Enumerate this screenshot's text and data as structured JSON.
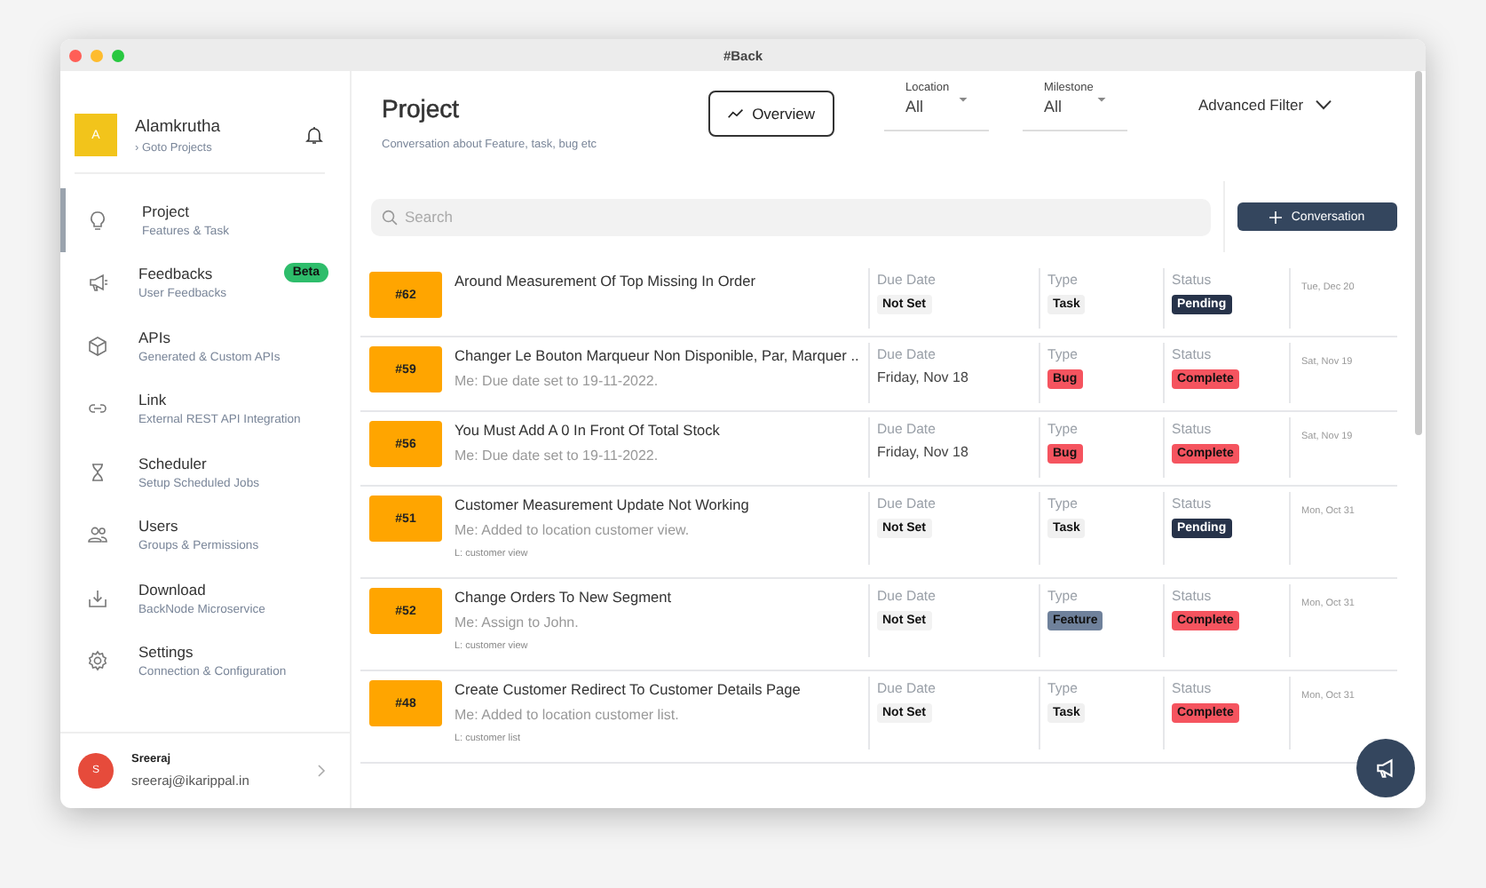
{
  "window": {
    "title": "#Back"
  },
  "sidebar": {
    "workspace": {
      "initial": "A",
      "name": "Alamkrutha",
      "link": "› Goto Projects"
    },
    "items": [
      {
        "title": "Project",
        "subtitle": "Features & Task",
        "selected": true
      },
      {
        "title": "Feedbacks",
        "subtitle": "User Feedbacks",
        "selected": false,
        "badge": "Beta"
      },
      {
        "title": "APIs",
        "subtitle": "Generated & Custom APIs",
        "selected": false
      },
      {
        "title": "Link",
        "subtitle": "External REST API Integration",
        "selected": false
      },
      {
        "title": "Scheduler",
        "subtitle": "Setup Scheduled Jobs",
        "selected": false
      },
      {
        "title": "Users",
        "subtitle": "Groups & Permissions",
        "selected": false
      },
      {
        "title": "Download",
        "subtitle": "BackNode Microservice",
        "selected": false
      },
      {
        "title": "Settings",
        "subtitle": "Connection & Configuration",
        "selected": false
      }
    ],
    "user": {
      "initial": "S",
      "name": "Sreeraj",
      "email": "sreeraj@ikarippal.in"
    }
  },
  "header": {
    "title": "Project",
    "subtitle": "Conversation about Feature, task, bug etc",
    "overview_button": "Overview",
    "filters": [
      {
        "label": "Location",
        "value": "All"
      },
      {
        "label": "Milestone",
        "value": "All"
      }
    ],
    "advanced_filter": "Advanced Filter"
  },
  "search": {
    "placeholder": "Search"
  },
  "new_button": "Conversation",
  "rows": [
    {
      "number": "#62",
      "title": "Around Measurement Of Top Missing In Order",
      "due_label": "Due Date",
      "due": {
        "kind": "unset",
        "text": "Not Set"
      },
      "type_label": "Type",
      "type": {
        "kind": "task",
        "text": "Task"
      },
      "status_label": "Status",
      "status": {
        "kind": "pending",
        "text": "Pending"
      },
      "date": "Tue, Dec 20"
    },
    {
      "number": "#59",
      "title": "Changer Le Bouton Marqueur Non Disponible, Par, Marquer ..",
      "message": "Me: Due date set to 19-11-2022.",
      "due_label": "Due Date",
      "due": {
        "kind": "date",
        "text": "Friday, Nov 18"
      },
      "type_label": "Type",
      "type": {
        "kind": "bug",
        "text": "Bug"
      },
      "status_label": "Status",
      "status": {
        "kind": "complete",
        "text": "Complete"
      },
      "date": "Sat, Nov 19"
    },
    {
      "number": "#56",
      "title": "You Must Add A 0 In Front Of Total Stock",
      "message": "Me: Due date set to 19-11-2022.",
      "due_label": "Due Date",
      "due": {
        "kind": "date",
        "text": "Friday, Nov 18"
      },
      "type_label": "Type",
      "type": {
        "kind": "bug",
        "text": "Bug"
      },
      "status_label": "Status",
      "status": {
        "kind": "complete",
        "text": "Complete"
      },
      "date": "Sat, Nov 19"
    },
    {
      "number": "#51",
      "title": "Customer Measurement Update Not Working",
      "message": "Me: Added to location customer view.",
      "location": "L: customer view",
      "due_label": "Due Date",
      "due": {
        "kind": "unset",
        "text": "Not Set"
      },
      "type_label": "Type",
      "type": {
        "kind": "task",
        "text": "Task"
      },
      "status_label": "Status",
      "status": {
        "kind": "pending",
        "text": "Pending"
      },
      "date": "Mon, Oct 31"
    },
    {
      "number": "#52",
      "title": "Change Orders To New Segment",
      "message": "Me: Assign to John.",
      "location": "L: customer view",
      "due_label": "Due Date",
      "due": {
        "kind": "unset",
        "text": "Not Set"
      },
      "type_label": "Type",
      "type": {
        "kind": "feature",
        "text": "Feature"
      },
      "status_label": "Status",
      "status": {
        "kind": "complete",
        "text": "Complete"
      },
      "date": "Mon, Oct 31"
    },
    {
      "number": "#48",
      "title": "Create Customer Redirect To Customer Details Page",
      "message": "Me: Added to location customer list.",
      "location": "L: customer list",
      "due_label": "Due Date",
      "due": {
        "kind": "unset",
        "text": "Not Set"
      },
      "type_label": "Type",
      "type": {
        "kind": "task",
        "text": "Task"
      },
      "status_label": "Status",
      "status": {
        "kind": "complete",
        "text": "Complete"
      },
      "date": "Mon, Oct 31"
    }
  ]
}
